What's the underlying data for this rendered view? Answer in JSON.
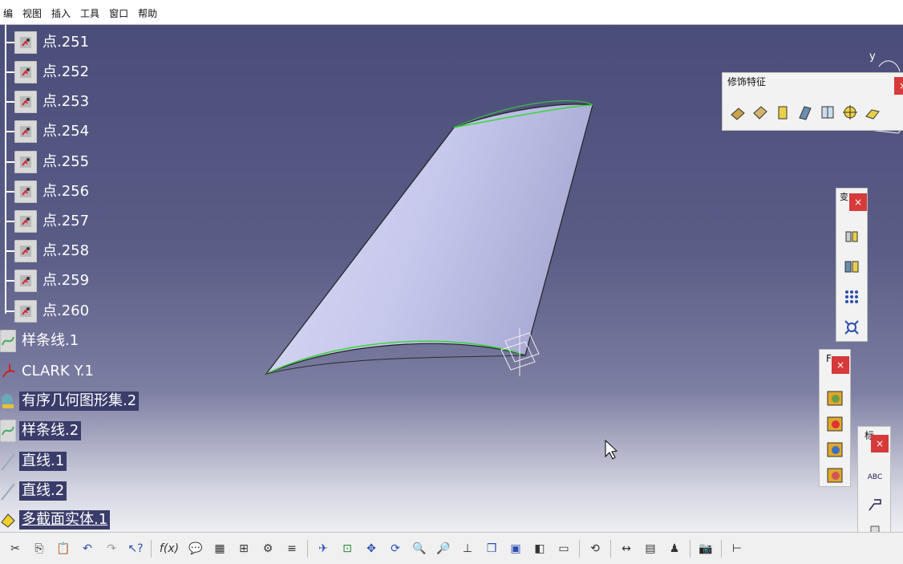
{
  "menubar": {
    "items": [
      "编",
      "视图",
      "插入",
      "工具",
      "窗口",
      "帮助"
    ]
  },
  "tree": {
    "points": [
      "点.251",
      "点.252",
      "点.253",
      "点.254",
      "点.255",
      "点.256",
      "点.257",
      "点.258",
      "点.259",
      "点.260"
    ],
    "items": [
      "样条线.1",
      "CLARK Y.1",
      "有序几何图形集.2",
      "样条线.2",
      "直线.1",
      "直线.2",
      "多截面实体.1"
    ]
  },
  "panels": {
    "decoration": {
      "title": "修饰特征",
      "close": "×"
    },
    "panel2": {
      "title": "变",
      "close": "×"
    },
    "panel3": {
      "title": "F",
      "close": "×"
    },
    "panel4": {
      "title": "标",
      "close": "×"
    },
    "abc_label": "ABC"
  },
  "compass": {
    "axis_y": "y"
  },
  "bottom_toolbar": {
    "formula_label": "f(x)"
  },
  "colors": {
    "viewport_top": "#4a4d79",
    "viewport_bottom": "#eeeef3",
    "surface": "#c9cbee",
    "edge_green": "#39d43a",
    "close_red": "#d63a3a"
  },
  "icons": [
    "cut-icon",
    "copy-icon",
    "paste-icon",
    "undo-icon",
    "redo-icon",
    "whats-this-icon",
    "formula-icon",
    "comment-icon",
    "table-icon",
    "tree-icon",
    "part-icon",
    "sketch-icon",
    "fit-all-icon",
    "pan-icon",
    "rotate-icon",
    "zoom-in-icon",
    "zoom-out-icon",
    "normal-view-icon",
    "views-icon",
    "shading-icon",
    "hide-show-icon",
    "swap-icon",
    "measure-icon",
    "camera-icon"
  ]
}
